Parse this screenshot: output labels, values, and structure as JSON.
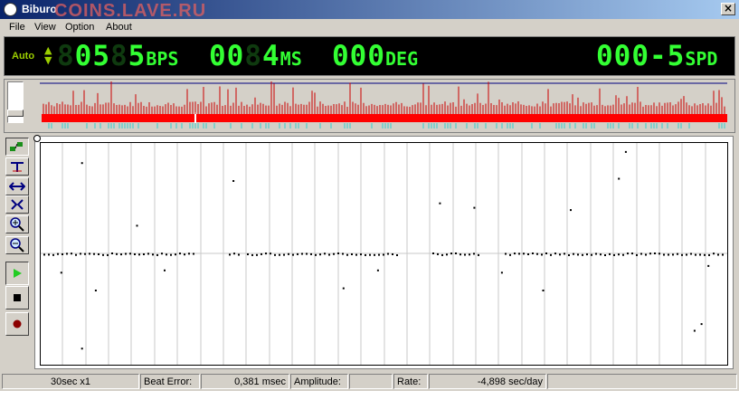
{
  "window": {
    "title": "Biburo",
    "close_glyph": "×"
  },
  "watermark": "COINS.LAVE.RU",
  "menu": [
    {
      "label": "File"
    },
    {
      "label": "View"
    },
    {
      "label": "Option"
    },
    {
      "label": "About"
    }
  ],
  "lcd": {
    "mode": "Auto",
    "arrows": "▲\n▼",
    "bps": {
      "value": "05",
      "ghost": "8",
      "digit": "5",
      "unit": "BPS"
    },
    "ms": {
      "value": "00",
      "ghost": "8",
      "digit": "4",
      "unit": "MS"
    },
    "deg": {
      "value": "000",
      "unit": "DEG"
    },
    "spd": {
      "value": "000-5",
      "unit": "SPD"
    },
    "colors": {
      "on": "#33ff33",
      "off": "#0f3a0f",
      "label": "#9ccf00",
      "background": "#000000"
    }
  },
  "overview": {
    "colors": {
      "band": "#ff0000",
      "ticks": "#cc0000",
      "cyan": "#33cccc",
      "line": "#000080"
    }
  },
  "toolbar": [
    {
      "name": "step-tool",
      "icon": "step-icon"
    },
    {
      "name": "cursor-tool",
      "icon": "cursor-icon"
    },
    {
      "name": "stretch-horizontal-tool",
      "icon": "stretch-horizontal-icon"
    },
    {
      "name": "fit-tool",
      "icon": "fit-icon"
    },
    {
      "name": "zoom-in-tool",
      "icon": "zoom-in-icon"
    },
    {
      "name": "zoom-out-tool",
      "icon": "zoom-out-icon"
    },
    {
      "name": "play-button",
      "icon": "play-icon"
    },
    {
      "name": "stop-button",
      "icon": "stop-icon"
    },
    {
      "name": "record-button",
      "icon": "record-icon"
    }
  ],
  "status": {
    "scale": "30sec x1",
    "beat_error_label": "Beat Error:",
    "beat_error_value": "0,381 msec",
    "amplitude_label": "Amplitude:",
    "amplitude_value": "",
    "rate_label": "Rate:",
    "rate_value": "-4,898 sec/day"
  },
  "chart_data": {
    "type": "scatter",
    "grid": true,
    "title": "",
    "xlabel": "",
    "ylabel": "",
    "note": "timegrapher trace: regular dot line near centre with scattered outliers",
    "outlier_points": [
      [
        0.03,
        0.42
      ],
      [
        0.06,
        0.91
      ],
      [
        0.06,
        0.08
      ],
      [
        0.08,
        0.34
      ],
      [
        0.14,
        0.63
      ],
      [
        0.18,
        0.43
      ],
      [
        0.28,
        0.83
      ],
      [
        0.44,
        0.35
      ],
      [
        0.49,
        0.43
      ],
      [
        0.58,
        0.73
      ],
      [
        0.63,
        0.71
      ],
      [
        0.67,
        0.42
      ],
      [
        0.73,
        0.34
      ],
      [
        0.77,
        0.7
      ],
      [
        0.84,
        0.84
      ],
      [
        0.85,
        0.96
      ],
      [
        0.95,
        0.16
      ],
      [
        0.96,
        0.19
      ],
      [
        0.97,
        0.45
      ]
    ]
  }
}
